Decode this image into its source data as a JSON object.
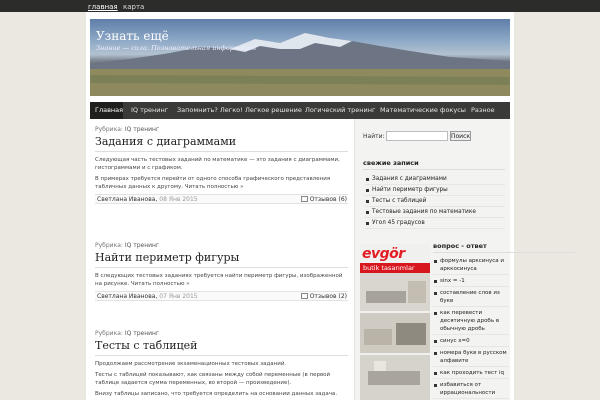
{
  "topbar": {
    "home": "главная",
    "map": "карта"
  },
  "site": {
    "title": "Узнать ещё",
    "description": "Знание — сила. Познавательная информация"
  },
  "nav": [
    "Главная",
    "IQ тренинг",
    "Запомнить? Легко!",
    "Легкое решение",
    "Логический тренинг",
    "Математические фокусы",
    "Разное"
  ],
  "posts": [
    {
      "category_prefix": "Рубрика:",
      "category": "IQ тренинг",
      "title": "Задания с диаграммами",
      "paragraphs": [
        "Следующая часть тестовых заданий по математике — это задания с диаграммами,",
        "гистограммами и с графиком.",
        "В примерах требуется перейти от одного способа графического представления",
        "табличных данных к другому. Читать полностью »"
      ],
      "author": "Светлана Иванова",
      "date": "08 Янв 2015",
      "comments": "Отзывов (6)"
    },
    {
      "category_prefix": "Рубрика:",
      "category": "IQ тренинг",
      "title": "Найти периметр фигуры",
      "paragraphs": [
        "В следующих тестовых заданиях требуется найти периметр фигуры, изображенной на",
        "рисунке. Читать полностью »"
      ],
      "author": "Светлана Иванова",
      "date": "07 Янв 2015",
      "comments": "Отзывов (2)"
    },
    {
      "category_prefix": "Рубрика:",
      "category": "IQ тренинг",
      "title": "Тесты с таблицей",
      "paragraphs": [
        "Продолжаем рассмотрение экзаменационных тестовых заданий.",
        "Тесты с таблицей показывают, как связаны между собой переменные (в первой таблице",
        "задается сумма переменных, во второй — произведение).",
        "Внизу таблицы записано, что требуется определить на основании данных задача."
      ],
      "author": "",
      "date": "",
      "comments": ""
    }
  ],
  "sidebar": {
    "search_label": "Найти:",
    "search_button": "Поиск",
    "recent_title": "свежие записи",
    "recent": [
      "Задания с диаграммами",
      "Найти периметр фигуры",
      "Тесты с таблицей",
      "Тестовые задания по математике",
      "Угол 45 градусов"
    ],
    "questions_title": "вопрос - ответ",
    "questions": [
      "формулы арксинуса и арккосинуса",
      "sinx = -1",
      "составление слов из букв",
      "как перевести десятичную дробь в обычную дробь",
      "синус x=0",
      "номера букв в русском алфавите",
      "как проходить тест iq",
      "избавиться от иррациональности"
    ],
    "ad_logo": "evgör",
    "ad_tagline": "butik tasarımlar"
  }
}
